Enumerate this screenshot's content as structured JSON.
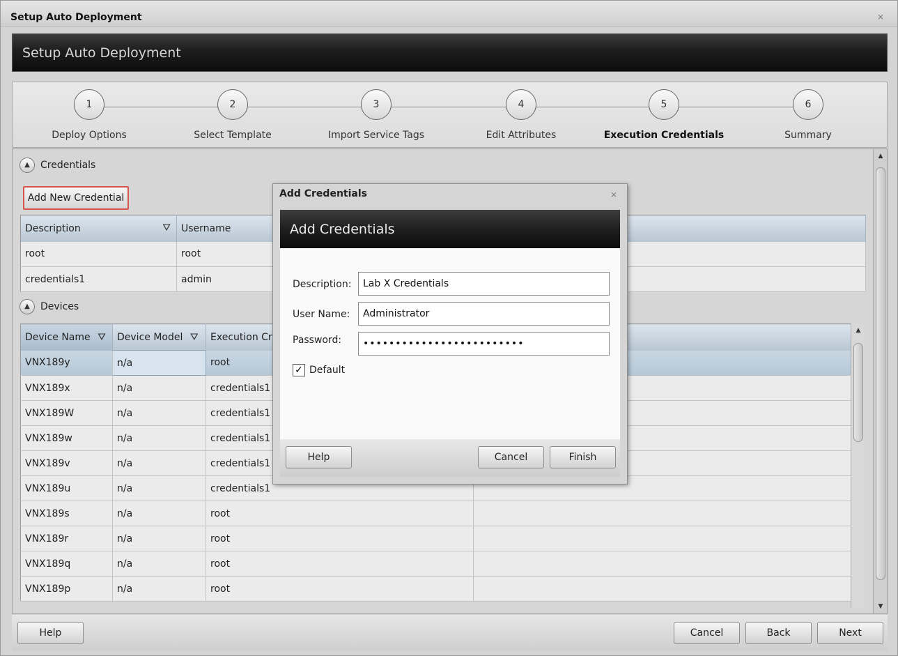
{
  "window": {
    "title": "Setup Auto Deployment",
    "close_glyph": "⨯"
  },
  "header": {
    "title": "Setup Auto Deployment"
  },
  "wizard": {
    "steps": [
      {
        "number": "1",
        "label": "Deploy Options"
      },
      {
        "number": "2",
        "label": "Select Template"
      },
      {
        "number": "3",
        "label": "Import Service Tags"
      },
      {
        "number": "4",
        "label": "Edit Attributes"
      },
      {
        "number": "5",
        "label": "Execution Credentials",
        "active": true
      },
      {
        "number": "6",
        "label": "Summary"
      }
    ]
  },
  "credentials_section": {
    "title": "Credentials",
    "add_button": "Add New Credential",
    "columns": [
      "Description",
      "Username"
    ],
    "rows": [
      [
        "root",
        "root"
      ],
      [
        "credentials1",
        "admin"
      ]
    ]
  },
  "devices_section": {
    "title": "Devices",
    "columns": [
      "Device Name",
      "Device Model",
      "Execution Cr"
    ],
    "rows": [
      [
        "VNX189y",
        "n/a",
        "root"
      ],
      [
        "VNX189x",
        "n/a",
        "credentials1"
      ],
      [
        "VNX189W",
        "n/a",
        "credentials1"
      ],
      [
        "VNX189w",
        "n/a",
        "credentials1"
      ],
      [
        "VNX189v",
        "n/a",
        "credentials1"
      ],
      [
        "VNX189u",
        "n/a",
        "credentials1"
      ],
      [
        "VNX189s",
        "n/a",
        "root"
      ],
      [
        "VNX189r",
        "n/a",
        "root"
      ],
      [
        "VNX189q",
        "n/a",
        "root"
      ],
      [
        "VNX189p",
        "n/a",
        "root"
      ]
    ],
    "selected_row": 0
  },
  "footer": {
    "help": "Help",
    "cancel": "Cancel",
    "back": "Back",
    "next": "Next"
  },
  "modal": {
    "title": "Add Credentials",
    "header": "Add Credentials",
    "close_glyph": "⨯",
    "fields": {
      "description_label": "Description:",
      "description_value": "Lab X Credentials",
      "username_label": "User Name:",
      "username_value": "Administrator",
      "password_label": "Password:",
      "password_value": "•••••••••••••••••••••••••"
    },
    "default_label": "Default",
    "default_checked": true,
    "buttons": {
      "help": "Help",
      "cancel": "Cancel",
      "finish": "Finish"
    }
  },
  "icons": {
    "filter": "funnel-icon",
    "collapse": "chevron-up-icon",
    "check": "checkmark-icon"
  },
  "colors": {
    "header_dark": "#1d1d1d",
    "grid_header": "#b8c6d3",
    "highlight_border": "#d9534f",
    "selected_row": "#c9d7e3"
  }
}
